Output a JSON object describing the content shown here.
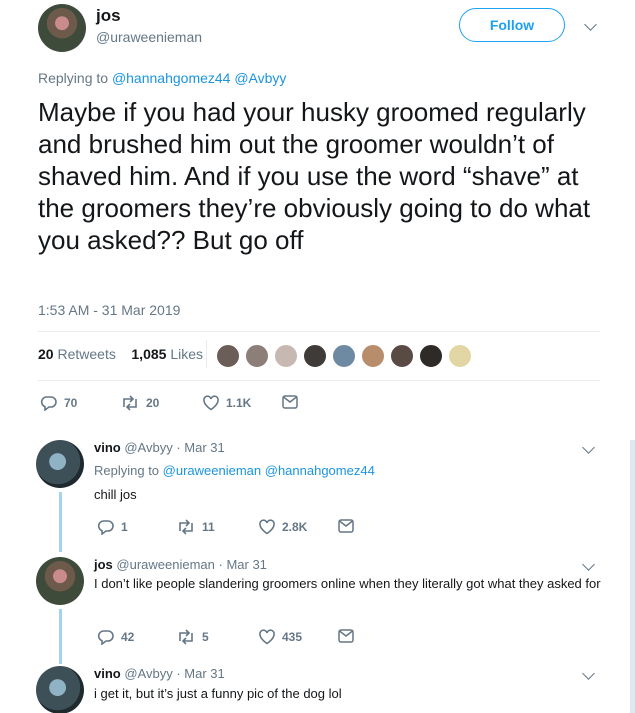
{
  "main_tweet": {
    "name": "jos",
    "handle": "@uraweenieman",
    "follow_label": "Follow",
    "replying_prefix": "Replying to",
    "replying_to": "@hannahgomez44 @Avbyy",
    "text": "Maybe if you had your husky groomed regularly and brushed him out the groomer wouldn’t of shaved him. And if you use the word “shave” at the groomers they’re obviously going to do what you asked?? But go off",
    "timestamp": "1:53 AM - 31 Mar 2019",
    "retweets_count": "20",
    "retweets_label": "Retweets",
    "likes_count": "1,085",
    "likes_label": "Likes",
    "actions": {
      "replies": "70",
      "retweets": "20",
      "likes": "1.1K"
    }
  },
  "replies": [
    {
      "name": "vino",
      "handle_date": "@Avbyy · Mar 31",
      "replying_prefix": "Replying to",
      "replying_to": "@uraweenieman @hannahgomez44",
      "text": "chill jos",
      "actions": {
        "replies": "1",
        "retweets": "11",
        "likes": "2.8K"
      }
    },
    {
      "name": "jos",
      "handle_date": "@uraweenieman · Mar 31",
      "text": "I don’t like people slandering groomers online when they literally got what they asked for",
      "actions": {
        "replies": "42",
        "retweets": "5",
        "likes": "435"
      }
    },
    {
      "name": "vino",
      "handle_date": "@Avbyy · Mar 31",
      "text": "i get it, but it’s just a funny pic of the dog lol"
    }
  ],
  "colors": {
    "accent": "#1da1f2",
    "link": "#1b95e0",
    "muted": "#657786",
    "thread": "#a5d3ec"
  },
  "icons": [
    "reply-icon",
    "retweet-icon",
    "heart-icon",
    "mail-icon",
    "chevron-down-icon"
  ]
}
